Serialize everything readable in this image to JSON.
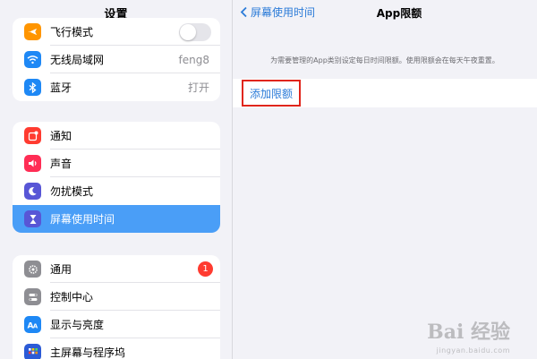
{
  "sidebar": {
    "title": "设置",
    "groups": [
      {
        "items": [
          {
            "label": "飞行模式",
            "icon": "airplane-icon",
            "color": "#ff9500",
            "accessory": "toggle",
            "value": "off"
          },
          {
            "label": "无线局域网",
            "icon": "wifi-icon",
            "color": "#1e88f5",
            "accessory": "text",
            "value": "feng8"
          },
          {
            "label": "蓝牙",
            "icon": "bluetooth-icon",
            "color": "#1e88f5",
            "accessory": "text",
            "value": "打开"
          }
        ]
      },
      {
        "items": [
          {
            "label": "通知",
            "icon": "notification-icon",
            "color": "#ff3b30"
          },
          {
            "label": "声音",
            "icon": "speaker-icon",
            "color": "#ff2d55"
          },
          {
            "label": "勿扰模式",
            "icon": "moon-icon",
            "color": "#5856d6"
          },
          {
            "label": "屏幕使用时间",
            "icon": "hourglass-icon",
            "color": "#5856d6",
            "selected": true
          }
        ]
      },
      {
        "items": [
          {
            "label": "通用",
            "icon": "gear-icon",
            "color": "#8e8e93",
            "accessory": "badge",
            "value": "1"
          },
          {
            "label": "控制中心",
            "icon": "switches-icon",
            "color": "#8e8e93"
          },
          {
            "label": "显示与亮度",
            "icon": "text-size-icon",
            "color": "#1e88f5"
          },
          {
            "label": "主屏幕与程序坞",
            "icon": "home-grid-icon",
            "color": "#2c5bd6"
          }
        ]
      }
    ]
  },
  "detail": {
    "back_label": "屏幕使用时间",
    "title": "App限额",
    "description": "为需要管理的App类别设定每日时间限额。使用限额会在每天午夜重置。",
    "add_limit_label": "添加限额"
  },
  "watermark": {
    "brand": "Bai 经验",
    "url": "jingyan.baidu.com"
  },
  "colors": {
    "accent": "#2b7bd8",
    "selected_row": "#4a9ef7",
    "highlight_box": "#e0251b",
    "badge": "#ff3b30"
  }
}
